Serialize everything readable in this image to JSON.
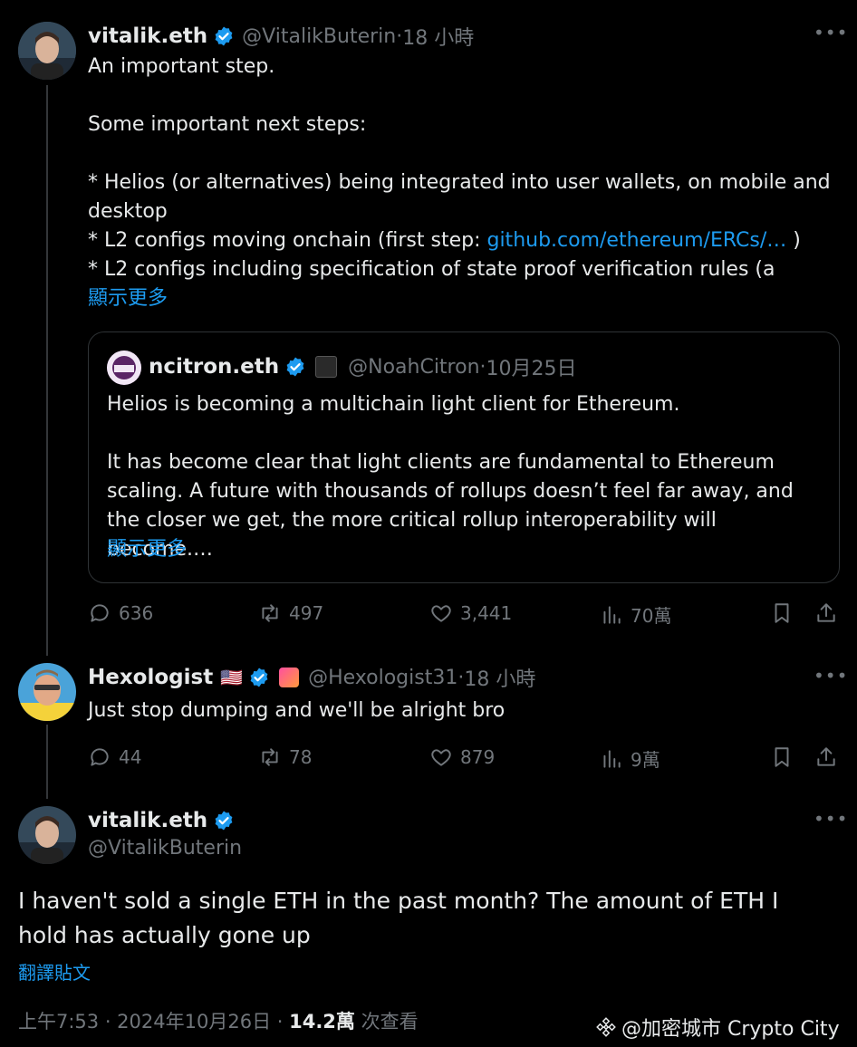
{
  "tweet1": {
    "name": "vitalik.eth",
    "handle": "@VitalikButerin",
    "time": "18 小時",
    "body": "An important step.\n\nSome important next steps:\n\n* Helios (or alternatives) being integrated into user wallets, on mobile and desktop\n* L2 configs moving onchain (first step: ",
    "link_text": "github.com/ethereum/ERCs/…",
    "body_after_link": " )\n* L2 configs including specification of state proof verification rules (a",
    "show_more": "顯示更多",
    "quote": {
      "name": "ncitron.eth",
      "handle": "@NoahCitron",
      "time": "10月25日",
      "body": "Helios is becoming a multichain light client for Ethereum.\n\nIt has become clear that light clients are fundamental to Ethereum scaling. A future with thousands of rollups doesn’t feel far away, and the closer we get, the more critical rollup interoperability will become.…",
      "show_more": "顯示更多"
    },
    "stats": {
      "replies": "636",
      "retweets": "497",
      "likes": "3,441",
      "views": "70萬"
    }
  },
  "tweet2": {
    "name": "Hexologist",
    "flag": "🇺🇸",
    "handle": "@Hexologist31",
    "time": "18 小時",
    "body": "Just stop dumping and we'll be alright bro",
    "stats": {
      "replies": "44",
      "retweets": "78",
      "likes": "879",
      "views": "9萬"
    }
  },
  "tweet3": {
    "name": "vitalik.eth",
    "handle": "@VitalikButerin",
    "body": "I haven't sold a single ETH in the past month? The amount of ETH I hold has actually gone up",
    "translate": "翻譯貼文",
    "timestamp": "上午7:53 · 2024年10月26日 · ",
    "views_count": "14.2萬",
    "views_label": " 次查看"
  },
  "watermark": "@加密城市 Crypto City",
  "separator": " · ",
  "colors": {
    "background": "#000000",
    "text": "#e7e9ea",
    "muted": "#71767b",
    "link": "#1d9bf0",
    "verified": "#1d9bf0"
  }
}
